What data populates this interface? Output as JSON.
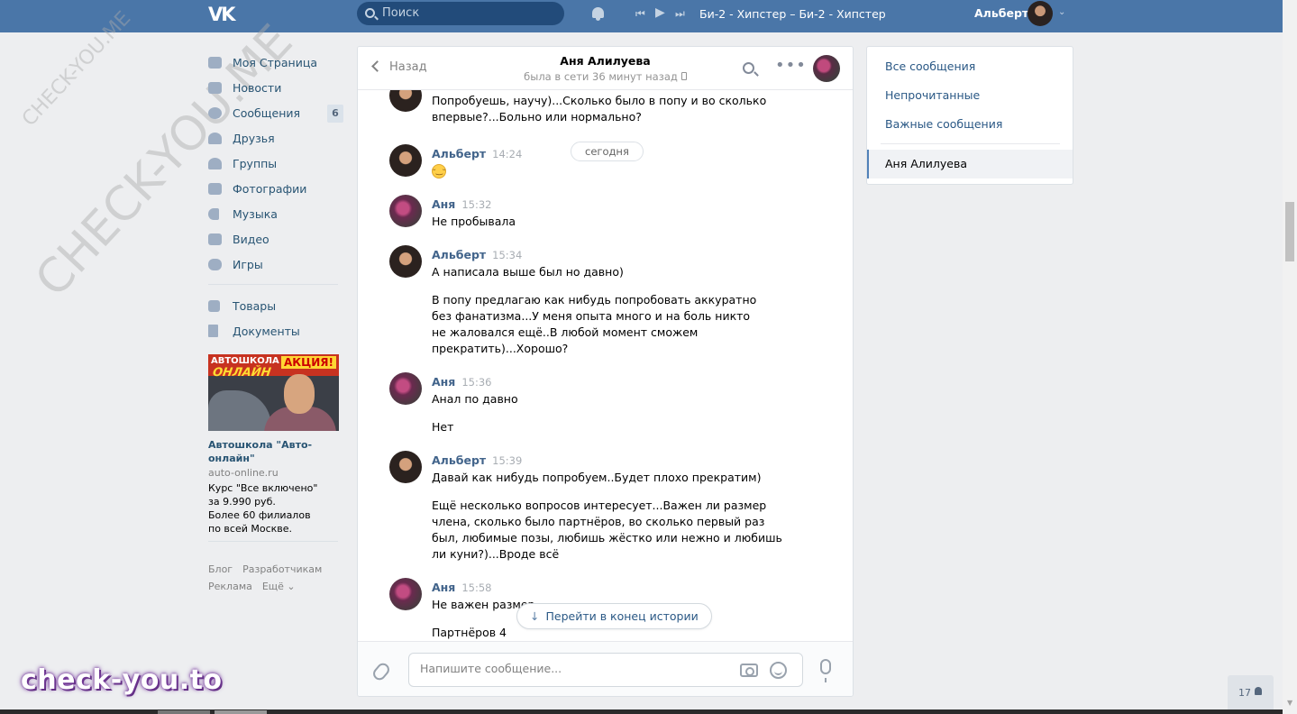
{
  "header": {
    "logo": "VK",
    "search_placeholder": "Поиск",
    "player": {
      "prev": "⏮",
      "play": "▶",
      "next": "⏭",
      "track": "Би-2 - Хипстер – Би-2 - Хипстер"
    },
    "user_name": "Альберт",
    "colors": {
      "bar": "#4a76a8",
      "search": "#224b7a"
    }
  },
  "watermarks": {
    "small": "CHECK-YOU.ME",
    "large": "CHECK-YOU.ME",
    "badge": "check-you.to"
  },
  "nav": {
    "items": [
      {
        "label": "Моя Страница",
        "icon": "home-icon"
      },
      {
        "label": "Новости",
        "icon": "news-icon"
      },
      {
        "label": "Сообщения",
        "icon": "messages-icon",
        "count": "6"
      },
      {
        "label": "Друзья",
        "icon": "friends-icon"
      },
      {
        "label": "Группы",
        "icon": "groups-icon"
      },
      {
        "label": "Фотографии",
        "icon": "camera-icon"
      },
      {
        "label": "Музыка",
        "icon": "music-icon"
      },
      {
        "label": "Видео",
        "icon": "video-icon"
      },
      {
        "label": "Игры",
        "icon": "games-icon"
      }
    ],
    "items2": [
      {
        "label": "Товары",
        "icon": "bag-icon"
      },
      {
        "label": "Документы",
        "icon": "document-icon"
      }
    ]
  },
  "ad": {
    "banner_top": "АВТОШКОЛА",
    "banner_brand": "ОНЛАЙН",
    "banner_promo": "АКЦИЯ!",
    "title": "Автошкола \"Авто-онлайн\"",
    "domain": "auto-online.ru",
    "text": [
      "Курс \"Все включено\"",
      "за 9.990 руб.",
      "Более 60 филиалов",
      "по всей Москве."
    ]
  },
  "footer": {
    "blog": "Блог",
    "devs": "Разработчикам",
    "ads": "Реклама",
    "more": "Ещё ⌄"
  },
  "chat": {
    "back": "Назад",
    "name": "Аня Алилуева",
    "status": "была в сети 36 минут назад",
    "date_pill": "сегодня",
    "jump": "Перейти в конец истории",
    "input_placeholder": "Напишите сообщение...",
    "partial_text": "Попробуешь, научу)...Сколько было в попу и во сколько впервые?...Больно или нормально?",
    "messages": [
      {
        "author": "Альберт",
        "time": "14:24",
        "lines": [],
        "emoji": true
      },
      {
        "author": "Аня",
        "time": "15:32",
        "lines": [
          "Не пробывала"
        ]
      },
      {
        "author": "Альберт",
        "time": "15:34",
        "lines": [
          "А написала выше был но давно)",
          "В попу предлагаю как нибудь попробовать аккуратно без фанатизма...У меня опыта много и на боль никто не жаловался ещё..В любой момент сможем прекратить)...Хорошо?"
        ]
      },
      {
        "author": "Аня",
        "time": "15:36",
        "lines": [
          "Анал по давно",
          "Нет"
        ]
      },
      {
        "author": "Альберт",
        "time": "15:39",
        "lines": [
          "Давай как нибудь попробуем..Будет плохо прекратим)",
          "Ещё несколько вопросов интересует...Важен ли размер члена, сколько было партнёров, во сколько первый раз был, любимые позы, любишь жёстко или нежно и любишь ли куни?)...Вроде всё"
        ]
      },
      {
        "author": "Аня",
        "time": "15:58",
        "lines": [
          "Не важен размер",
          "Партнёров 4"
        ]
      }
    ]
  },
  "right_panel": {
    "all": "Все сообщения",
    "unread": "Непрочитанные",
    "important": "Важные сообщения",
    "active": "Аня Алилуева"
  },
  "online_count": "17"
}
